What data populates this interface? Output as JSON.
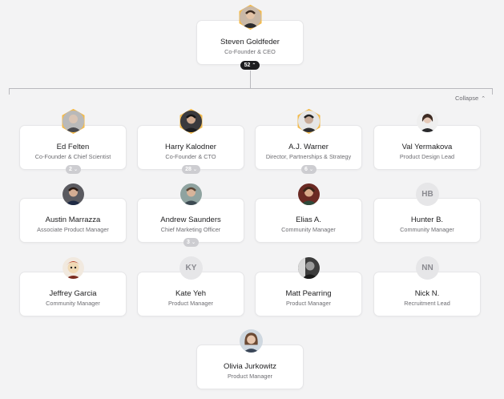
{
  "root": {
    "name": "Steven Goldfeder",
    "role": "Co-Founder & CEO",
    "count": "52"
  },
  "collapse_label": "Collapse",
  "people": [
    {
      "name": "Ed Felten",
      "role": "Co-Founder & Chief Scientist",
      "count": "2"
    },
    {
      "name": "Harry Kalodner",
      "role": "Co-Founder & CTO",
      "count": "28"
    },
    {
      "name": "A.J. Warner",
      "role": "Director, Partnerships & Strategy",
      "count": "6"
    },
    {
      "name": "Val Yermakova",
      "role": "Product Design Lead"
    },
    {
      "name": "Austin Marrazza",
      "role": "Associate Product Manager"
    },
    {
      "name": "Andrew Saunders",
      "role": "Chief Marketing Officer",
      "count": "3"
    },
    {
      "name": "Elias A.",
      "role": "Community Manager"
    },
    {
      "name": "Hunter B.",
      "role": "Community Manager",
      "initials": "HB"
    },
    {
      "name": "Jeffrey Garcia",
      "role": "Community Manager"
    },
    {
      "name": "Kate Yeh",
      "role": "Product Manager",
      "initials": "KY"
    },
    {
      "name": "Matt Pearring",
      "role": "Product Manager"
    },
    {
      "name": "Nick N.",
      "role": "Recruitment Lead",
      "initials": "NN"
    },
    {
      "name": "Olivia Jurkowitz",
      "role": "Product Manager"
    }
  ],
  "colors": {
    "ring_gold": "#f2b94a",
    "ring_blue": "#4c8fe0",
    "badge_dark": "#1d1d1f",
    "badge_grey": "#cdcdd1"
  }
}
